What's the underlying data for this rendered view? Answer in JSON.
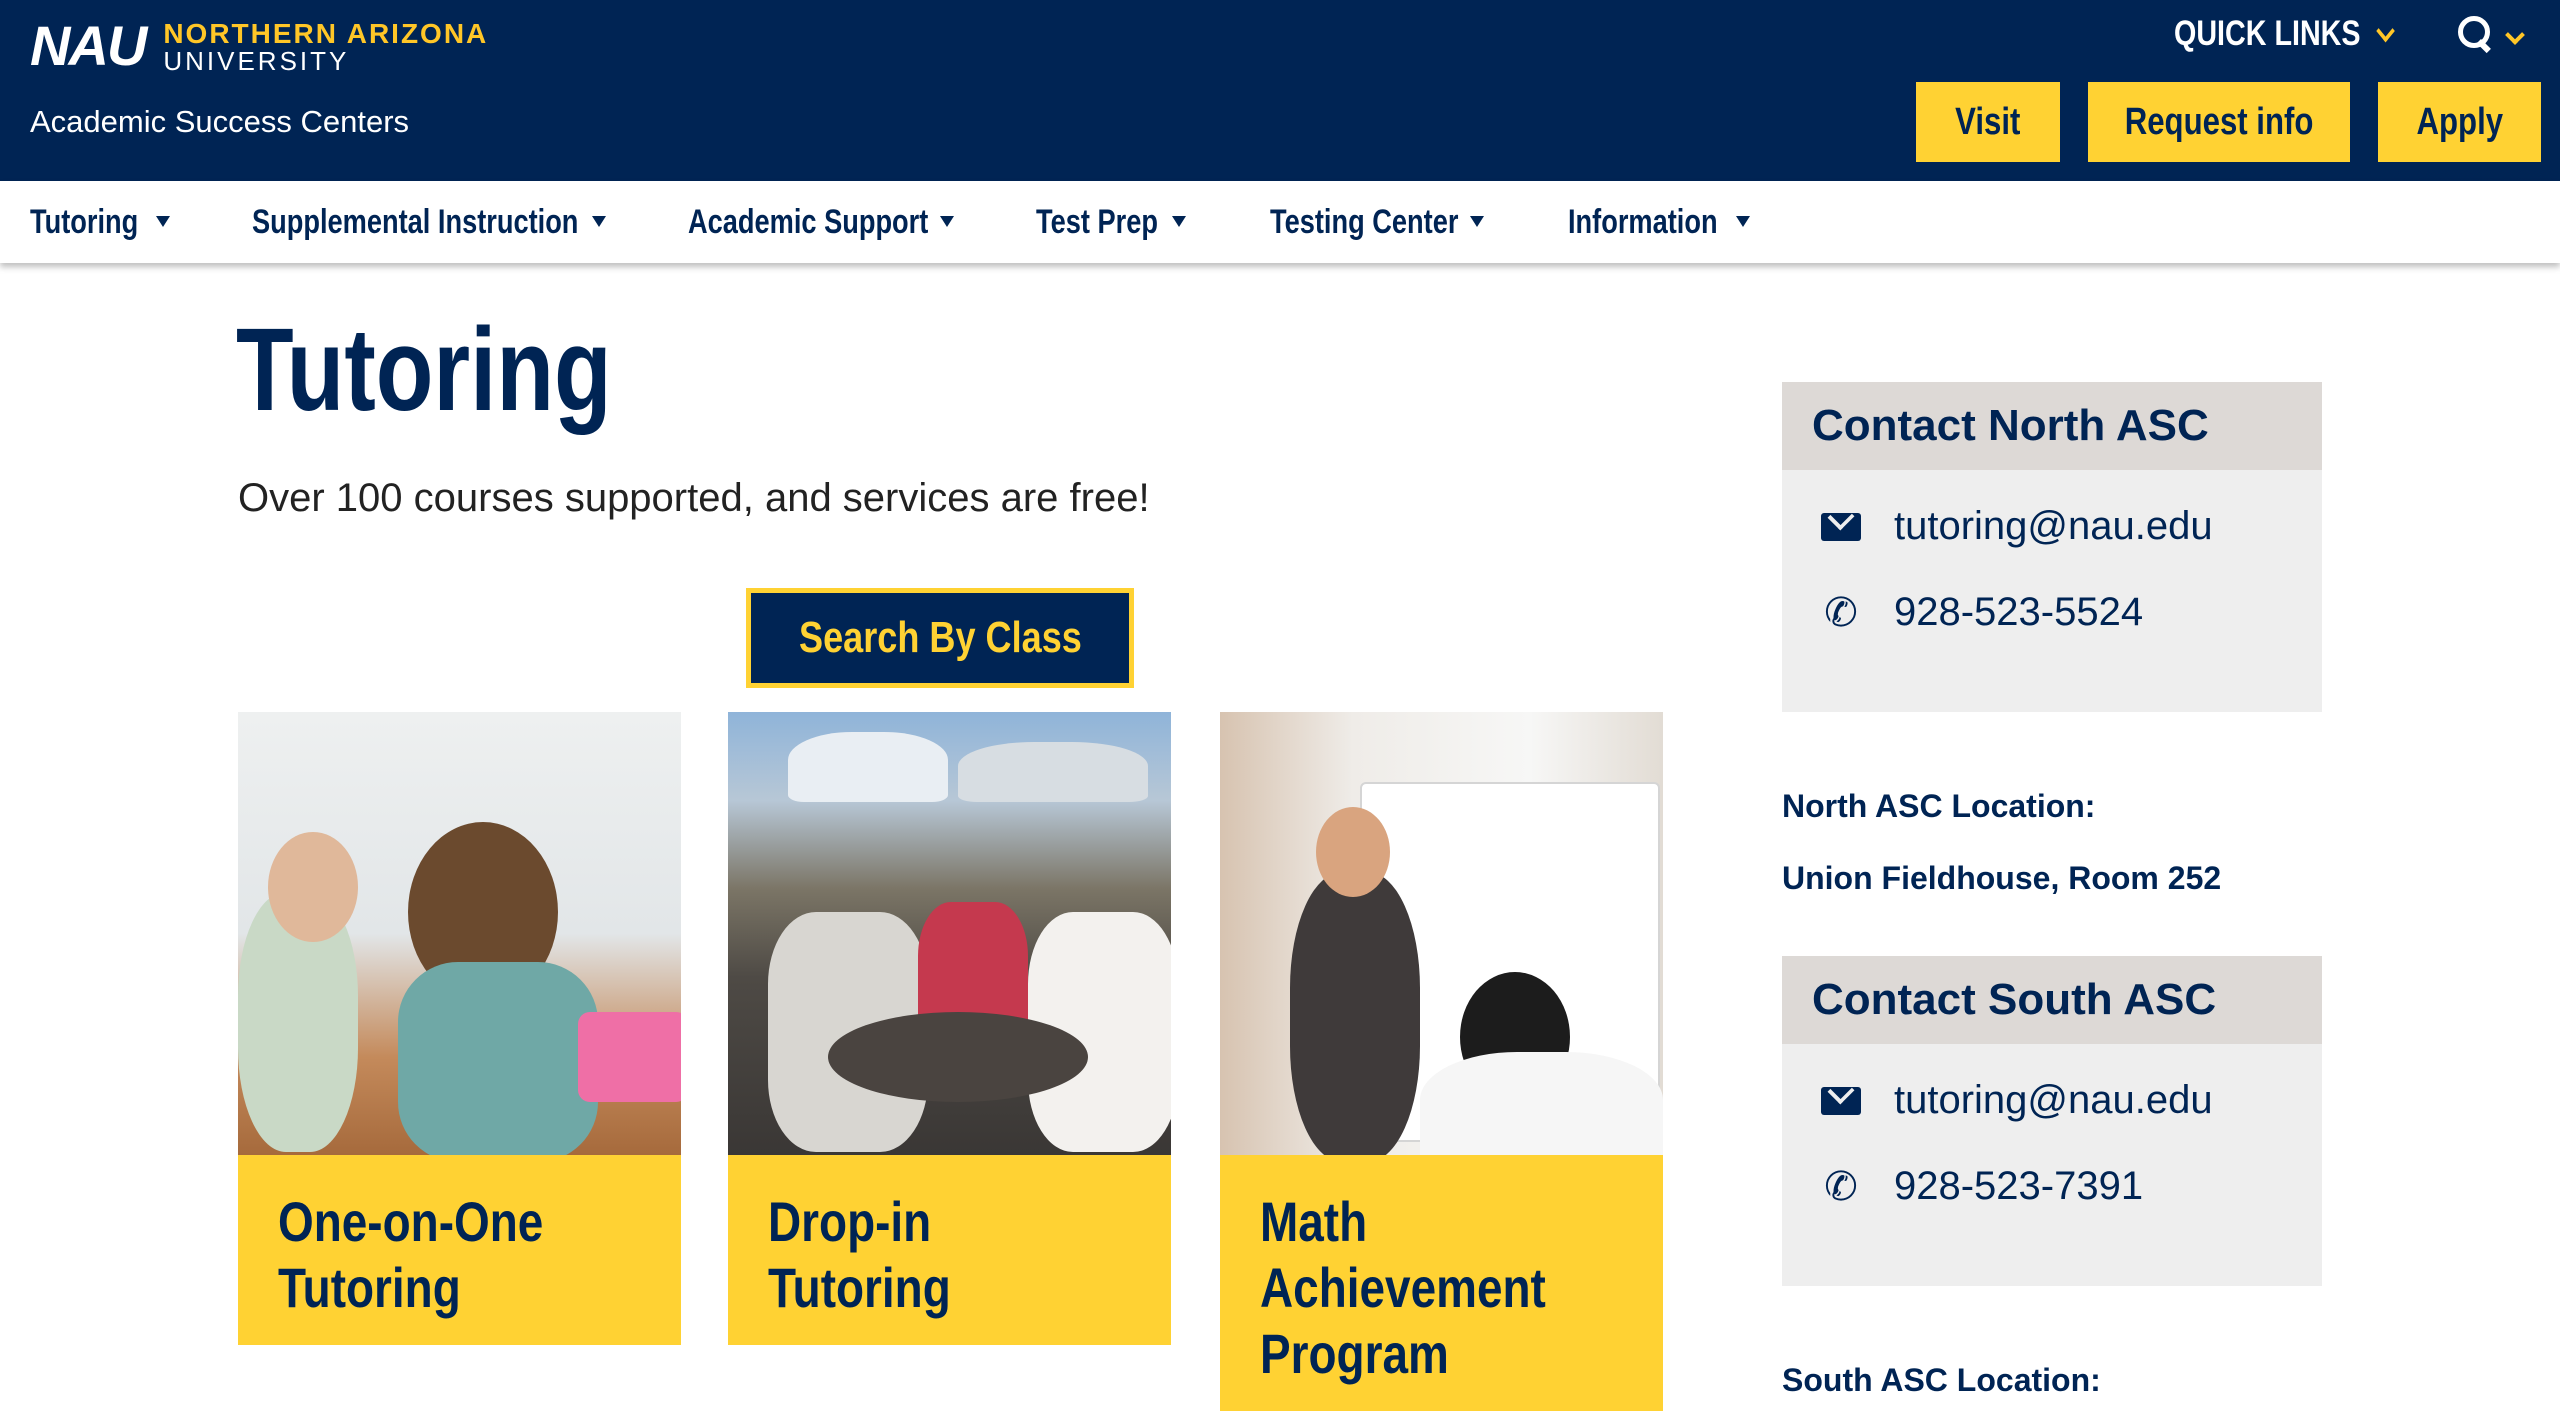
{
  "header": {
    "logo_mark": "NAU",
    "logo_line1": "NORTHERN ARIZONA",
    "logo_line2": "UNIVERSITY",
    "site_title": "Academic Success Centers",
    "quick_links": "QUICK LINKS",
    "buttons": {
      "visit": "Visit",
      "request_info": "Request info",
      "apply": "Apply"
    }
  },
  "nav": {
    "items": [
      {
        "label": "Tutoring"
      },
      {
        "label": "Supplemental Instruction"
      },
      {
        "label": "Academic Support"
      },
      {
        "label": "Test Prep"
      },
      {
        "label": "Testing Center"
      },
      {
        "label": "Information"
      }
    ]
  },
  "main": {
    "title": "Tutoring",
    "intro": "Over 100 courses supported, and services are free!",
    "search_button": "Search By Class",
    "cards": [
      {
        "line1": "One-on-One",
        "line2": "Tutoring",
        "line3": ""
      },
      {
        "line1": "Drop-in",
        "line2": "Tutoring",
        "line3": ""
      },
      {
        "line1": "Math",
        "line2": "Achievement",
        "line3": "Program"
      }
    ]
  },
  "sidebar": {
    "north": {
      "heading": "Contact North ASC",
      "email": "tutoring@nau.edu",
      "phone": "928-523-5524",
      "location_label": "North ASC Location:",
      "location": "Union Fieldhouse, Room 252"
    },
    "south": {
      "heading": "Contact South ASC",
      "email": "tutoring@nau.edu",
      "phone": "928-523-7391",
      "location_label": "South ASC Location:"
    }
  },
  "colors": {
    "navy": "#002454",
    "gold": "#ffd233",
    "gray_box": "#eeeeee",
    "gray_head": "#ddd9d6"
  }
}
